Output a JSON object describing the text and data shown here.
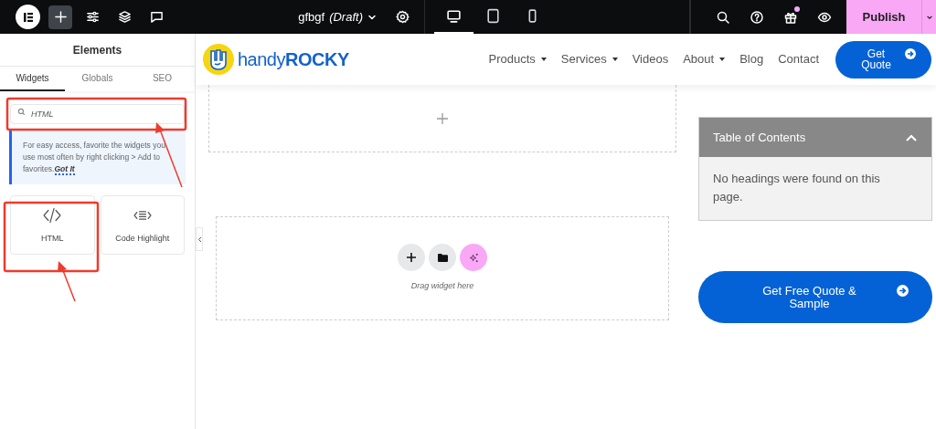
{
  "topbar": {
    "left_tools": [
      {
        "kind": "add",
        "selected": true
      },
      {
        "kind": "settings",
        "selected": false
      },
      {
        "kind": "layers",
        "selected": false
      },
      {
        "kind": "comments",
        "selected": false
      }
    ],
    "document": {
      "name": "gfbgf",
      "state": "(Draft)"
    },
    "devices": [
      {
        "kind": "desktop",
        "selected": true
      },
      {
        "kind": "tablet",
        "selected": false
      },
      {
        "kind": "mobile",
        "selected": false
      }
    ],
    "right_tools": [
      {
        "kind": "search",
        "notification": false
      },
      {
        "kind": "help",
        "notification": false
      },
      {
        "kind": "gift",
        "notification": true
      },
      {
        "kind": "preview",
        "notification": false
      }
    ],
    "publish": "Publish"
  },
  "panel": {
    "title": "Elements",
    "tabs": [
      {
        "label": "Widgets",
        "selected": true
      },
      {
        "label": "Globals",
        "selected": false
      },
      {
        "label": "SEO",
        "selected": false
      }
    ],
    "search": {
      "value": "HTML"
    },
    "tip": {
      "text": "For easy access, favorite the widgets you use most often by right clicking > Add to favorites.",
      "link": "Got It"
    },
    "widgets": [
      {
        "kind": "html",
        "label": "HTML"
      },
      {
        "kind": "code",
        "label": "Code Highlight"
      }
    ]
  },
  "site": {
    "logo": {
      "light": "handy",
      "bold": "ROCKY"
    },
    "nav": [
      {
        "label": "Products",
        "dropdown": true
      },
      {
        "label": "Services",
        "dropdown": true
      },
      {
        "label": "Videos",
        "dropdown": false
      },
      {
        "label": "About",
        "dropdown": true
      },
      {
        "label": "Blog",
        "dropdown": false
      },
      {
        "label": "Contact",
        "dropdown": false
      }
    ],
    "cta": "Get Quote",
    "drop_zone": {
      "hint": "Drag widget here"
    },
    "toc": {
      "title": "Table of Contents",
      "expanded": true,
      "empty_text": "No headings were found on this page."
    },
    "sample_button": "Get Free Quote & Sample"
  }
}
